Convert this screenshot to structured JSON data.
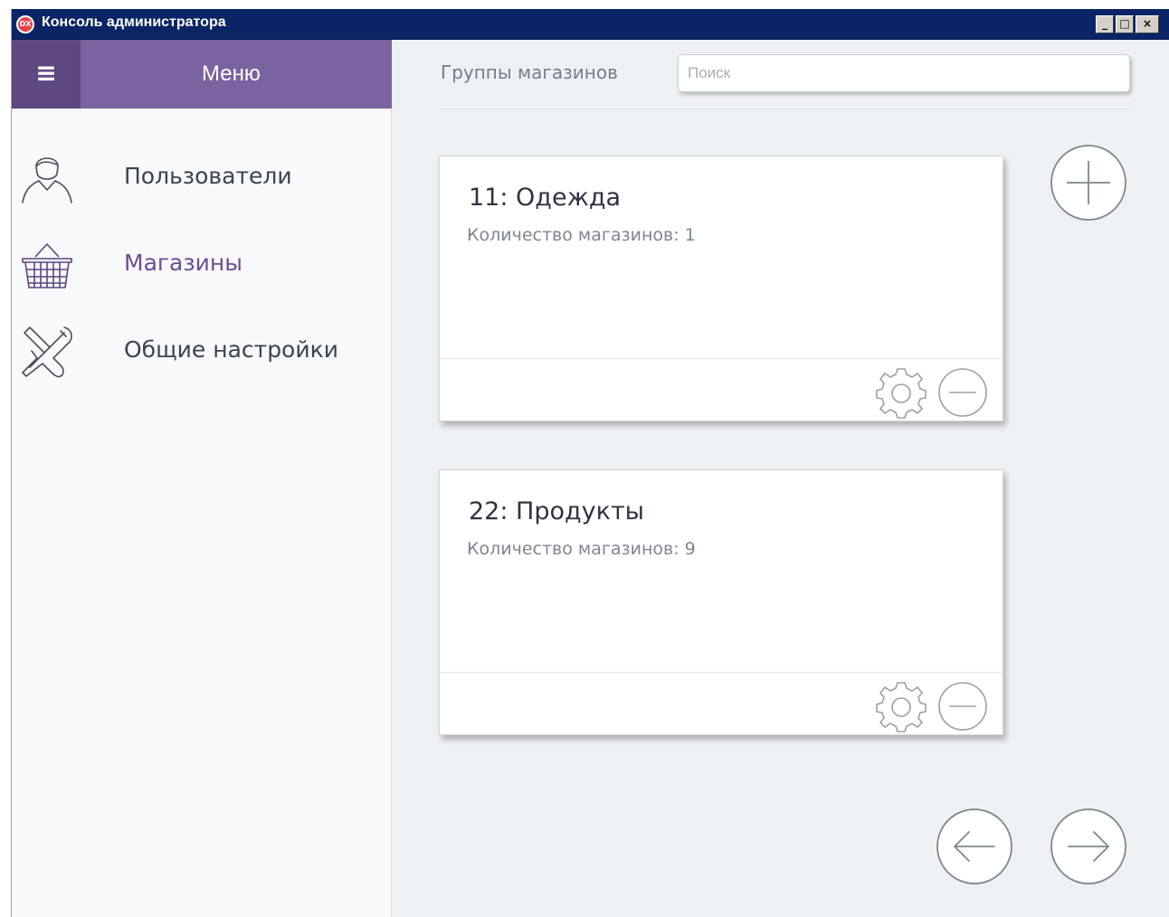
{
  "window": {
    "title": "Консоль администратора",
    "app_icon_text": "DX",
    "buttons": {
      "minimize": "_",
      "maximize": "□",
      "close": "×"
    }
  },
  "sidebar": {
    "menu_icon": "hamburger-icon",
    "menu_title": "Меню",
    "items": [
      {
        "label": "Пользователи",
        "icon": "user-icon",
        "active": false
      },
      {
        "label": "Магазины",
        "icon": "basket-icon",
        "active": true
      },
      {
        "label": "Общие настройки",
        "icon": "tools-icon",
        "active": false
      }
    ]
  },
  "main": {
    "section_title": "Группы магазинов",
    "search": {
      "placeholder": "Поиск",
      "value": ""
    },
    "groups": [
      {
        "title": "11: Одежда",
        "count_text": "Количество магазинов: 1"
      },
      {
        "title": "22: Продукты",
        "count_text": "Количество магазинов: 9"
      }
    ],
    "actions": {
      "add": "plus-icon",
      "prev": "arrow-left-icon",
      "next": "arrow-right-icon"
    }
  },
  "colors": {
    "titlebar": "#0a2466",
    "menu_header": "#7b62a0",
    "hamburger_bg": "#5f4782",
    "active_item": "#6b4e94",
    "content_bg": "#eef1f4"
  }
}
